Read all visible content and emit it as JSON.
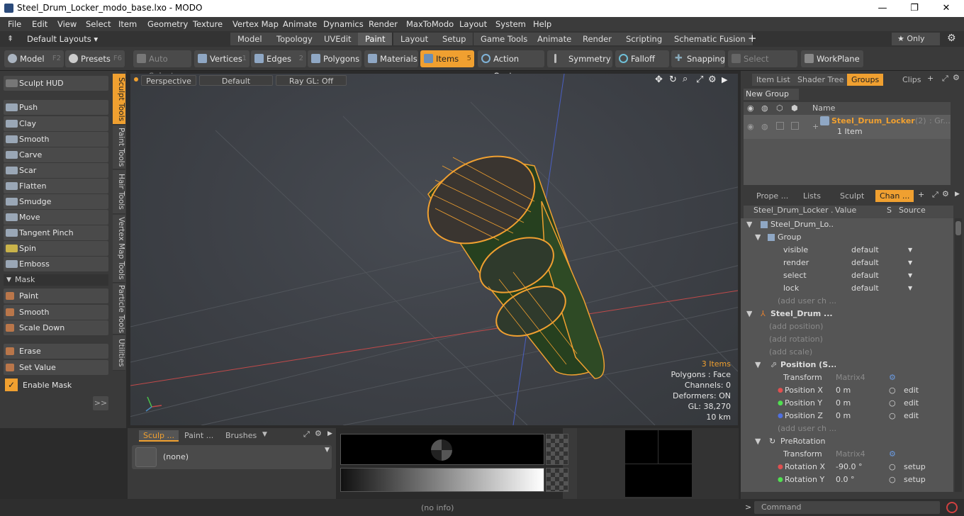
{
  "window": {
    "title": "Steel_Drum_Locker_modo_base.lxo - MODO",
    "minimize": "—",
    "maximize": "❐",
    "close": "✕"
  },
  "menu": [
    "File",
    "Edit",
    "View",
    "Select",
    "Item",
    "Geometry",
    "Texture",
    "Vertex Map",
    "Animate",
    "Dynamics",
    "Render",
    "MaxToModo",
    "Layout",
    "System",
    "Help"
  ],
  "layouts": {
    "dropdown": "Default Layouts ▾",
    "tabs": [
      "Model",
      "Topology",
      "UVEdit",
      "Paint",
      "Layout",
      "Setup",
      "Game Tools",
      "Animate",
      "Render",
      "Scripting",
      "Schematic Fusion"
    ],
    "active": "Paint",
    "add": "+",
    "only": "★  Only"
  },
  "toolbar": {
    "model": "Model",
    "model_key": "F2",
    "presets": "Presets",
    "presets_key": "F6",
    "auto_select": "Auto Select",
    "vertices": "Vertices",
    "vertices_key": "1",
    "edges": "Edges",
    "edges_key": "2",
    "polygons": "Polygons",
    "materials": "Materials",
    "items": "Items",
    "items_key": "5",
    "action_center": "Action Center",
    "symmetry": "Symmetry",
    "falloff": "Falloff",
    "snapping": "Snapping",
    "select_through": "Select Through",
    "workplane": "WorkPlane"
  },
  "sculpt": {
    "hud": "Sculpt HUD",
    "tools": [
      "Push",
      "Clay",
      "Smooth",
      "Carve",
      "Scar",
      "Flatten",
      "Smudge",
      "Move",
      "Tangent Pinch",
      "Spin",
      "Emboss"
    ],
    "mask_header": "Mask",
    "mask_tools": [
      "Paint",
      "Smooth",
      "Scale Down"
    ],
    "erase": "Erase",
    "set_value": "Set Value",
    "enable_mask": "Enable Mask",
    "more": ">>"
  },
  "vtabs": [
    "Sculpt Tools",
    "Paint Tools",
    "Hair Tools",
    "Vertex Map Tools",
    "Particle Tools",
    "Utilities"
  ],
  "viewport": {
    "view": "Perspective",
    "style": "Default",
    "raygl": "Ray GL: Off",
    "stats": [
      "3 Items",
      "Polygons : Face",
      "Channels: 0",
      "Deformers: ON",
      "GL: 38,270",
      "10 km"
    ]
  },
  "groups_panel": {
    "tabs": [
      "Item List",
      "Shader Tree",
      "Groups",
      "Clips"
    ],
    "active": "Groups",
    "new_group": "New Group",
    "name_header": "Name",
    "item_name": "Steel_Drum_Locker",
    "item_count": "(2)",
    "item_suffix": ": Gr...",
    "item_sub": "1 Item"
  },
  "channels_panel": {
    "tabs": [
      "Prope ...",
      "Lists",
      "Sculpt",
      "Chan ..."
    ],
    "active": "Chan ...",
    "headers": [
      "Steel_Drum_Locker ...",
      "Value",
      "S",
      "Source"
    ],
    "rows": [
      {
        "name": "Steel_Drum_Lo...",
        "value": "",
        "src": ""
      },
      {
        "name": "Group",
        "value": "",
        "src": ""
      },
      {
        "name": "visible",
        "value": "default",
        "src": ""
      },
      {
        "name": "render",
        "value": "default",
        "src": ""
      },
      {
        "name": "select",
        "value": "default",
        "src": ""
      },
      {
        "name": "lock",
        "value": "default",
        "src": ""
      },
      {
        "name": "(add user ch ...",
        "value": "",
        "src": ""
      },
      {
        "name": "Steel_Drum ...",
        "value": "",
        "src": ""
      },
      {
        "name": "(add position)",
        "value": "",
        "src": ""
      },
      {
        "name": "(add rotation)",
        "value": "",
        "src": ""
      },
      {
        "name": "(add scale)",
        "value": "",
        "src": ""
      },
      {
        "name": "Position (S...",
        "value": "",
        "src": ""
      },
      {
        "name": "Transform",
        "value": "Matrix4",
        "src": ""
      },
      {
        "name": "Position X",
        "value": "0 m",
        "src": "edit"
      },
      {
        "name": "Position Y",
        "value": "0 m",
        "src": "edit"
      },
      {
        "name": "Position Z",
        "value": "0 m",
        "src": "edit"
      },
      {
        "name": "(add user ch ...",
        "value": "",
        "src": ""
      },
      {
        "name": "PreRotation",
        "value": "",
        "src": ""
      },
      {
        "name": "Transform",
        "value": "Matrix4",
        "src": ""
      },
      {
        "name": "Rotation X",
        "value": "-90.0 °",
        "src": "setup"
      },
      {
        "name": "Rotation Y",
        "value": "0.0 °",
        "src": "setup"
      }
    ]
  },
  "bottom": {
    "tabs": [
      "Sculp ...",
      "Paint ...",
      "Brushes"
    ],
    "none": "(none)"
  },
  "status": {
    "info": "(no info)",
    "command": "Command",
    "prompt": ">"
  }
}
